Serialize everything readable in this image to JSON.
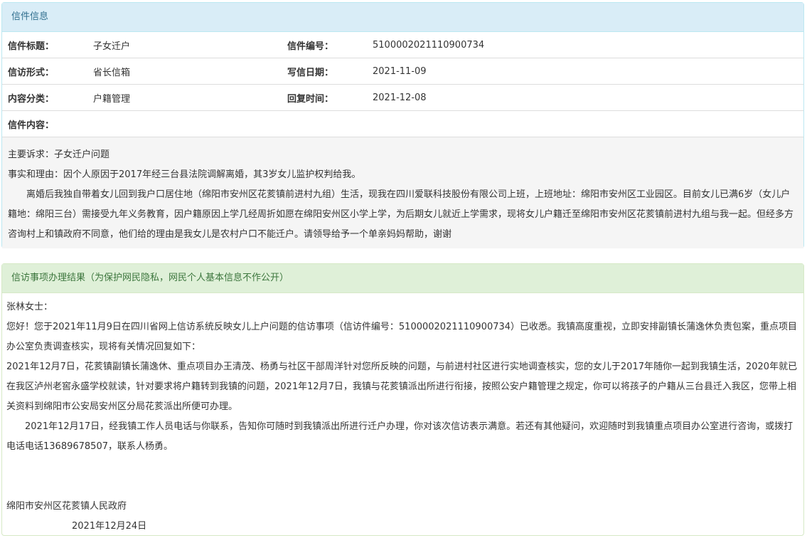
{
  "letter_info": {
    "header": "信件信息",
    "rows": [
      [
        {
          "label": "信件标题：",
          "value": "子女迁户"
        },
        {
          "label": "信件编号：",
          "value": "5100002021110900734"
        }
      ],
      [
        {
          "label": "信访形式：",
          "value": "省长信箱"
        },
        {
          "label": "写信日期：",
          "value": "2021-11-09"
        }
      ],
      [
        {
          "label": "内容分类：",
          "value": "户籍管理"
        },
        {
          "label": "回复时间：",
          "value": "2021-12-08"
        }
      ]
    ],
    "content_label": "信件内容：",
    "content_paragraphs": [
      "主要诉求：子女迁户问题",
      "事实和理由：因个人原因于2017年经三台县法院调解离婚，其3岁女儿监护权判给我。",
      "离婚后我独自带着女儿回到我户口居住地（绵阳市安州区花荄镇前进村九组）生活，现我在四川爱联科技股份有限公司上班，上班地址：绵阳市安州区工业园区。目前女儿已满6岁（女儿户籍地：绵阳三台）需接受九年义务教育，因户籍原因上学几经周折如愿在绵阳安州区小学上学，为后期女儿就近上学需求，现将女儿户籍迁至绵阳市安州区花荄镇前进村九组与我一起。但经多方咨询村上和镇政府不同意，他们给的理由是我女儿是农村户口不能迁户。请领导给予一个单亲妈妈帮助，谢谢"
    ]
  },
  "result": {
    "header": "信访事项办理结果（为保护网民隐私，网民个人基本信息不作公开）",
    "paragraphs": [
      "张林女士：",
      "您好！您于2021年11月9日在四川省网上信访系统反映女儿上户问题的信访事项（信访件编号：5100002021110900734）已收悉。我镇高度重视，立即安排副镇长蒲逸休负责包案，重点项目办公室负责调查核实，现将有关情况回复如下：",
      "2021年12月7日，花荄镇副镇长蒲逸休、重点项目办王清茂、杨勇与社区干部周洋针对您所反映的问题，与前进村社区进行实地调查核实，您的女儿于2017年随你一起到我镇生活，2020年就已在我区泸州老窖永盛学校就读，针对要求将户籍转到我镇的问题，2021年12月7日，我镇与花荄镇派出所进行衔接，按照公安户籍管理之规定，你可以将孩子的户籍从三台县迁入我区，您带上相关资料到绵阳市公安局安州区分局花荄派出所便可办理。",
      "2021年12月17日，经我镇工作人员电话与你联系，告知你可随时到我镇派出所进行迁户办理，你对该次信访表示满意。若还有其他疑问，欢迎随时到我镇重点项目办公室进行咨询，或拨打电话电话13689678507，联系人杨勇。"
    ],
    "signature": "绵阳市安州区花荄镇人民政府",
    "date": "2021年12月24日"
  }
}
